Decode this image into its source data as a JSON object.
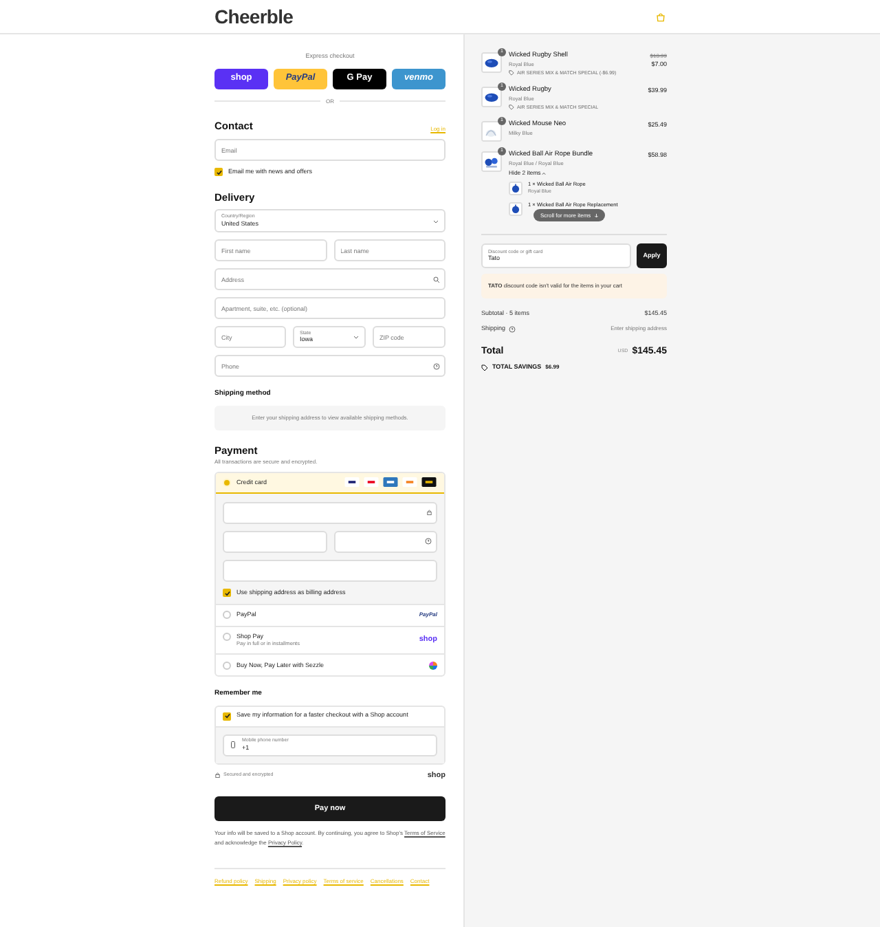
{
  "header": {
    "logo": "Cheerble"
  },
  "express": {
    "title": "Express checkout",
    "buttons": [
      {
        "kind": "shop",
        "label": "shop"
      },
      {
        "kind": "paypal",
        "label": "PayPal"
      },
      {
        "kind": "gpay",
        "label": "G Pay"
      },
      {
        "kind": "venmo",
        "label": "venmo"
      }
    ],
    "divider": "OR"
  },
  "contact": {
    "title": "Contact",
    "login": "Log in",
    "email": {
      "placeholder": "Email"
    },
    "news": {
      "label": "Email me with news and offers",
      "checked": true
    }
  },
  "delivery": {
    "title": "Delivery",
    "country": {
      "label": "Country/Region",
      "value": "United States"
    },
    "first_name": {
      "placeholder": "First name"
    },
    "last_name": {
      "placeholder": "Last name"
    },
    "address": {
      "placeholder": "Address"
    },
    "apartment": {
      "placeholder": "Apartment, suite, etc. (optional)"
    },
    "city": {
      "placeholder": "City"
    },
    "state": {
      "label": "State",
      "value": "Iowa"
    },
    "zip": {
      "placeholder": "ZIP code"
    },
    "phone": {
      "placeholder": "Phone"
    }
  },
  "shipping_method": {
    "title": "Shipping method",
    "message": "Enter your shipping address to view available shipping methods."
  },
  "payment": {
    "title": "Payment",
    "subtitle": "All transactions are secure and encrypted.",
    "billing": {
      "label": "Use shipping address as billing address",
      "checked": true
    },
    "methods": [
      {
        "kind": "card",
        "label": "Credit card",
        "selected": true
      },
      {
        "kind": "paypal",
        "label": "PayPal",
        "logo": "PayPal",
        "selected": false
      },
      {
        "kind": "shoppay",
        "label": "Shop Pay",
        "sublabel": "Pay in full or in installments",
        "logo": "shop",
        "selected": false
      },
      {
        "kind": "sezzle",
        "label": "Buy Now, Pay Later with Sezzle",
        "selected": false
      }
    ]
  },
  "remember": {
    "title": "Remember me",
    "save": {
      "label": "Save my information for a faster checkout with a Shop account",
      "checked": true
    },
    "phone": {
      "label": "Mobile phone number",
      "value": "+1"
    },
    "secure": "Secured and encrypted",
    "shop_logo": "shop"
  },
  "pay_button": "Pay now",
  "legal": {
    "before": "Your info will be saved to a Shop account. By continuing, you agree to Shop’s",
    "terms": "Terms of Service",
    "middle": "and acknowledge the",
    "privacy": "Privacy Policy",
    "after": "."
  },
  "footer_links": [
    "Refund policy",
    "Shipping",
    "Privacy policy",
    "Terms of service",
    "Cancellations",
    "Contact"
  ],
  "cart": {
    "items": [
      {
        "name": "Wicked Rugby Shell",
        "variant": "Royal Blue",
        "qty": "1",
        "old_price": "$13.99",
        "price": "$7.00",
        "discount": "AIR SERIES MIX & MATCH SPECIAL (-$6.99)"
      },
      {
        "name": "Wicked Rugby",
        "variant": "Royal Blue",
        "qty": "1",
        "price": "$39.99",
        "discount": "AIR SERIES MIX & MATCH SPECIAL"
      },
      {
        "name": "Wicked Mouse Neo",
        "variant": "Milky Blue",
        "qty": "1",
        "price": "$25.49"
      },
      {
        "name": "Wicked Ball Air Rope Bundle",
        "variant": "Royal Blue / Royal Blue",
        "qty": "1",
        "price": "$58.98",
        "toggle": "Hide 2 items",
        "expanded": true,
        "children": [
          {
            "name": "1 × Wicked Ball Air Rope",
            "variant": "Royal Blue"
          },
          {
            "name": "1 × Wicked Ball Air Rope Replacement"
          }
        ]
      }
    ],
    "scroll_hint": "Scroll for more items",
    "discount": {
      "label": "Discount code or gift card",
      "value": "Tato",
      "button": "Apply"
    },
    "notice": {
      "code": "TATO",
      "message": "discount code isn't valid for the items in your cart"
    },
    "subtotal": {
      "label": "Subtotal · 5 items",
      "value": "$145.45"
    },
    "shipping": {
      "label": "Shipping",
      "value": "Enter shipping address"
    },
    "total": {
      "label": "Total",
      "currency": "USD",
      "value": "$145.45"
    },
    "savings": {
      "label": "TOTAL SAVINGS",
      "value": "$6.99"
    }
  }
}
